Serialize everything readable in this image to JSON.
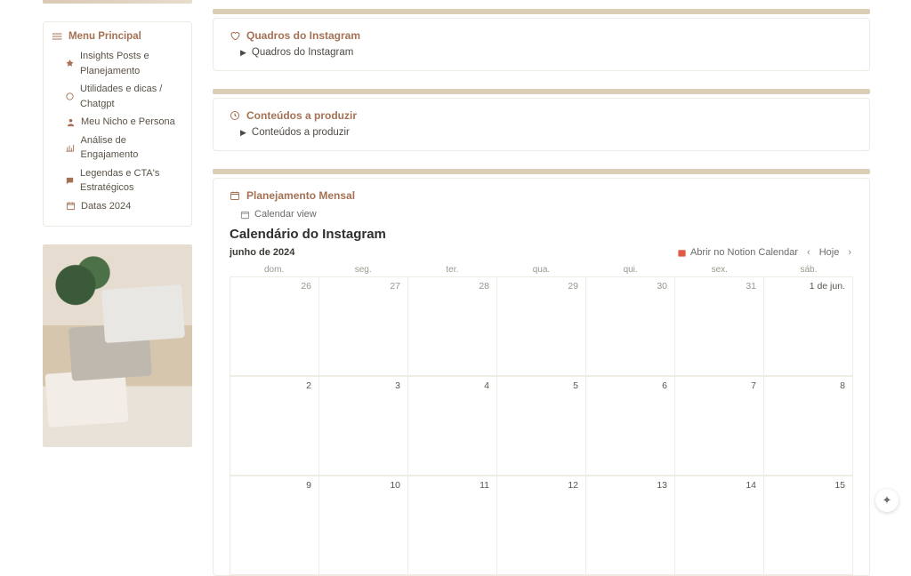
{
  "colors": {
    "accent": "#a57155",
    "bar": "#dccdb5"
  },
  "sidebar": {
    "menu_title": "Menu Principal",
    "items": [
      {
        "icon": "pin-icon",
        "label": "Insights Posts e Planejamento"
      },
      {
        "icon": "circle-icon",
        "label": "Utilidades e dicas / Chatgpt"
      },
      {
        "icon": "person-icon",
        "label": "Meu Nicho e Persona"
      },
      {
        "icon": "chart-icon",
        "label": "Análise de Engajamento"
      },
      {
        "icon": "speech-icon",
        "label": "Legendas e CTA's Estratégicos"
      },
      {
        "icon": "calendar-icon",
        "label": "Datas 2024"
      }
    ]
  },
  "sections": {
    "quadros": {
      "title": "Quadros do Instagram",
      "toggle": "Quadros do Instagram"
    },
    "produzir": {
      "title": "Conteúdos a produzir",
      "toggle": "Conteúdos a produzir"
    },
    "plan": {
      "title": "Planejamento Mensal",
      "view_label": "Calendar view",
      "heading": "Calendário do Instagram",
      "month_label": "junho de 2024",
      "open_label": "Abrir no Notion Calendar",
      "today_label": "Hoje",
      "dow": [
        "dom.",
        "seg.",
        "ter.",
        "qua.",
        "qui.",
        "sex.",
        "sáb."
      ],
      "cells": [
        {
          "label": "26",
          "in": false
        },
        {
          "label": "27",
          "in": false
        },
        {
          "label": "28",
          "in": false
        },
        {
          "label": "29",
          "in": false
        },
        {
          "label": "30",
          "in": false
        },
        {
          "label": "31",
          "in": false
        },
        {
          "label": "1 de jun.",
          "in": true
        },
        {
          "label": "2",
          "in": true
        },
        {
          "label": "3",
          "in": true
        },
        {
          "label": "4",
          "in": true
        },
        {
          "label": "5",
          "in": true
        },
        {
          "label": "6",
          "in": true
        },
        {
          "label": "7",
          "in": true
        },
        {
          "label": "8",
          "in": true
        },
        {
          "label": "9",
          "in": true
        },
        {
          "label": "10",
          "in": true
        },
        {
          "label": "11",
          "in": true
        },
        {
          "label": "12",
          "in": true
        },
        {
          "label": "13",
          "in": true
        },
        {
          "label": "14",
          "in": true
        },
        {
          "label": "15",
          "in": true
        }
      ]
    }
  }
}
